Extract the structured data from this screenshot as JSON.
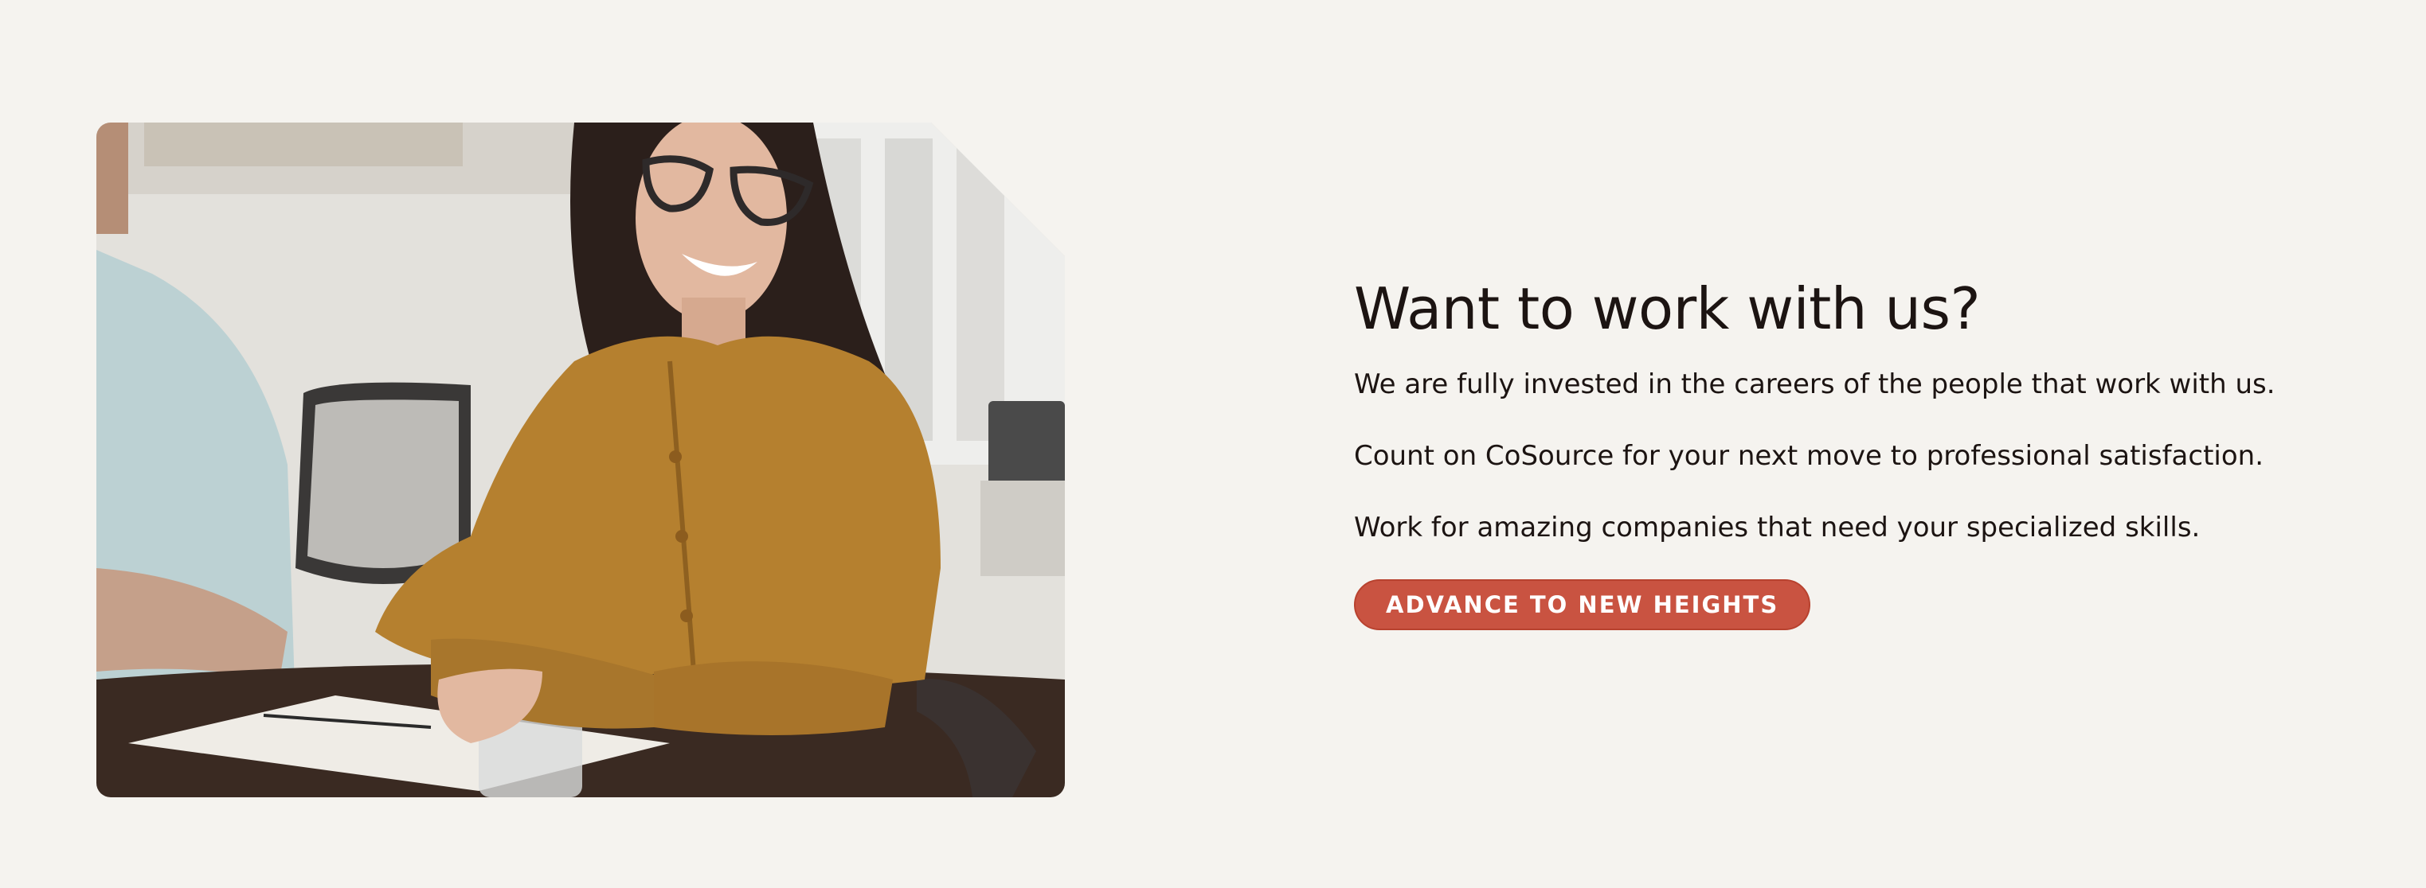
{
  "main": {
    "heading": "Want to work with us?",
    "paragraphs": [
      "We are fully invested in the careers of the people that work with us.",
      "Count on CoSource for your next move to professional satisfaction.",
      "Work for amazing companies that need your specialized skills."
    ],
    "cta_label": "ADVANCE TO NEW HEIGHTS"
  },
  "colors": {
    "background": "#f5f3ef",
    "text": "#1c1412",
    "accent": "#c95341"
  }
}
